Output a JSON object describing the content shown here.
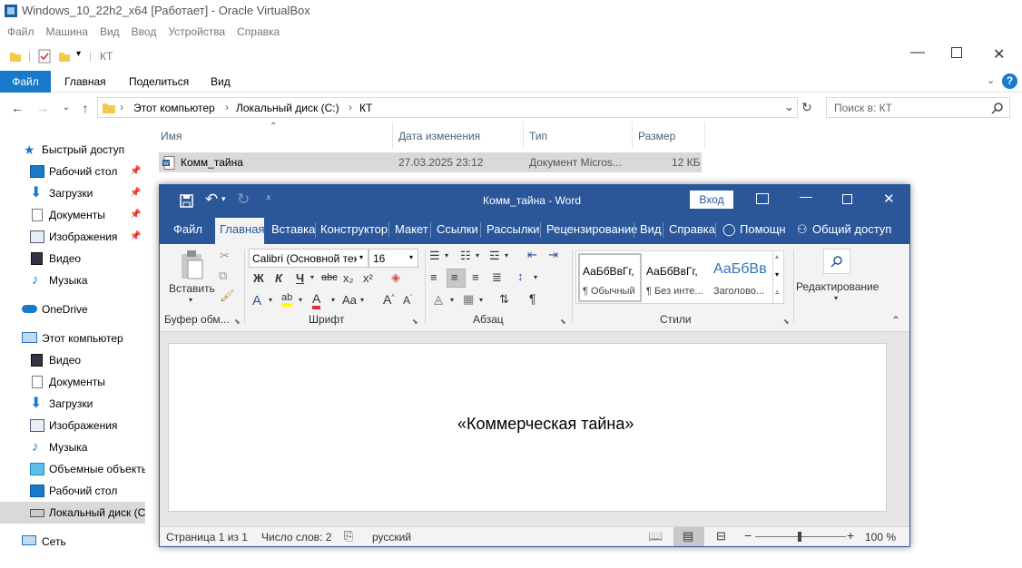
{
  "vbox": {
    "title": "Windows_10_22h2_x64 [Работает] - Oracle VirtualBox",
    "menu": [
      "Файл",
      "Машина",
      "Вид",
      "Ввод",
      "Устройства",
      "Справка"
    ]
  },
  "explorer": {
    "title": "КТ",
    "ribbon_tabs": [
      "Файл",
      "Главная",
      "Поделиться",
      "Вид"
    ],
    "address": {
      "crumbs": [
        "Этот компьютер",
        "Локальный диск (C:)",
        "КТ"
      ]
    },
    "search_placeholder": "Поиск в: КТ",
    "columns": [
      "Имя",
      "Дата изменения",
      "Тип",
      "Размер"
    ],
    "files": [
      {
        "name": "Комм_тайна",
        "modified": "27.03.2025 23:12",
        "type": "Документ Micros...",
        "size": "12 КБ"
      }
    ],
    "nav": {
      "quick_access": "Быстрый доступ",
      "quick_items": [
        "Рабочий стол",
        "Загрузки",
        "Документы",
        "Изображения",
        "Видео",
        "Музыка"
      ],
      "onedrive": "OneDrive",
      "this_pc": "Этот компьютер",
      "pc_items": [
        "Видео",
        "Документы",
        "Загрузки",
        "Изображения",
        "Музыка",
        "Объемные объекты",
        "Рабочий стол",
        "Локальный диск (C:)"
      ],
      "network": "Сеть"
    }
  },
  "word": {
    "title": "Комм_тайна  -  Word",
    "signin": "Вход",
    "tabs": [
      "Файл",
      "Главная",
      "Вставка",
      "Конструктор",
      "Макет",
      "Ссылки",
      "Рассылки",
      "Рецензирование",
      "Вид",
      "Справка",
      "Помощн",
      "Общий доступ"
    ],
    "ribbon": {
      "paste": "Вставить",
      "font_name": "Calibri (Основной тек",
      "font_size": "16",
      "bold": "Ж",
      "italic": "К",
      "underline": "Ч",
      "strike": "abc",
      "sub": "x₂",
      "sup": "x²",
      "change_case": "Aa",
      "styles": [
        {
          "preview": "АаБбВвГг,",
          "name": "¶ Обычный"
        },
        {
          "preview": "АаБбВвГг,",
          "name": "¶ Без инте..."
        },
        {
          "preview": "АаБбВв",
          "name": "Заголово..."
        }
      ],
      "editing": "Редактирование",
      "groups": [
        "Буфер обм...",
        "Шрифт",
        "Абзац",
        "Стили"
      ]
    },
    "document_text": "«Коммерческая тайна»",
    "status": {
      "page": "Страница 1 из 1",
      "words": "Число слов: 2",
      "lang": "русский",
      "zoom": "100 %"
    },
    "colors": {
      "accent": "#2b579a"
    }
  }
}
